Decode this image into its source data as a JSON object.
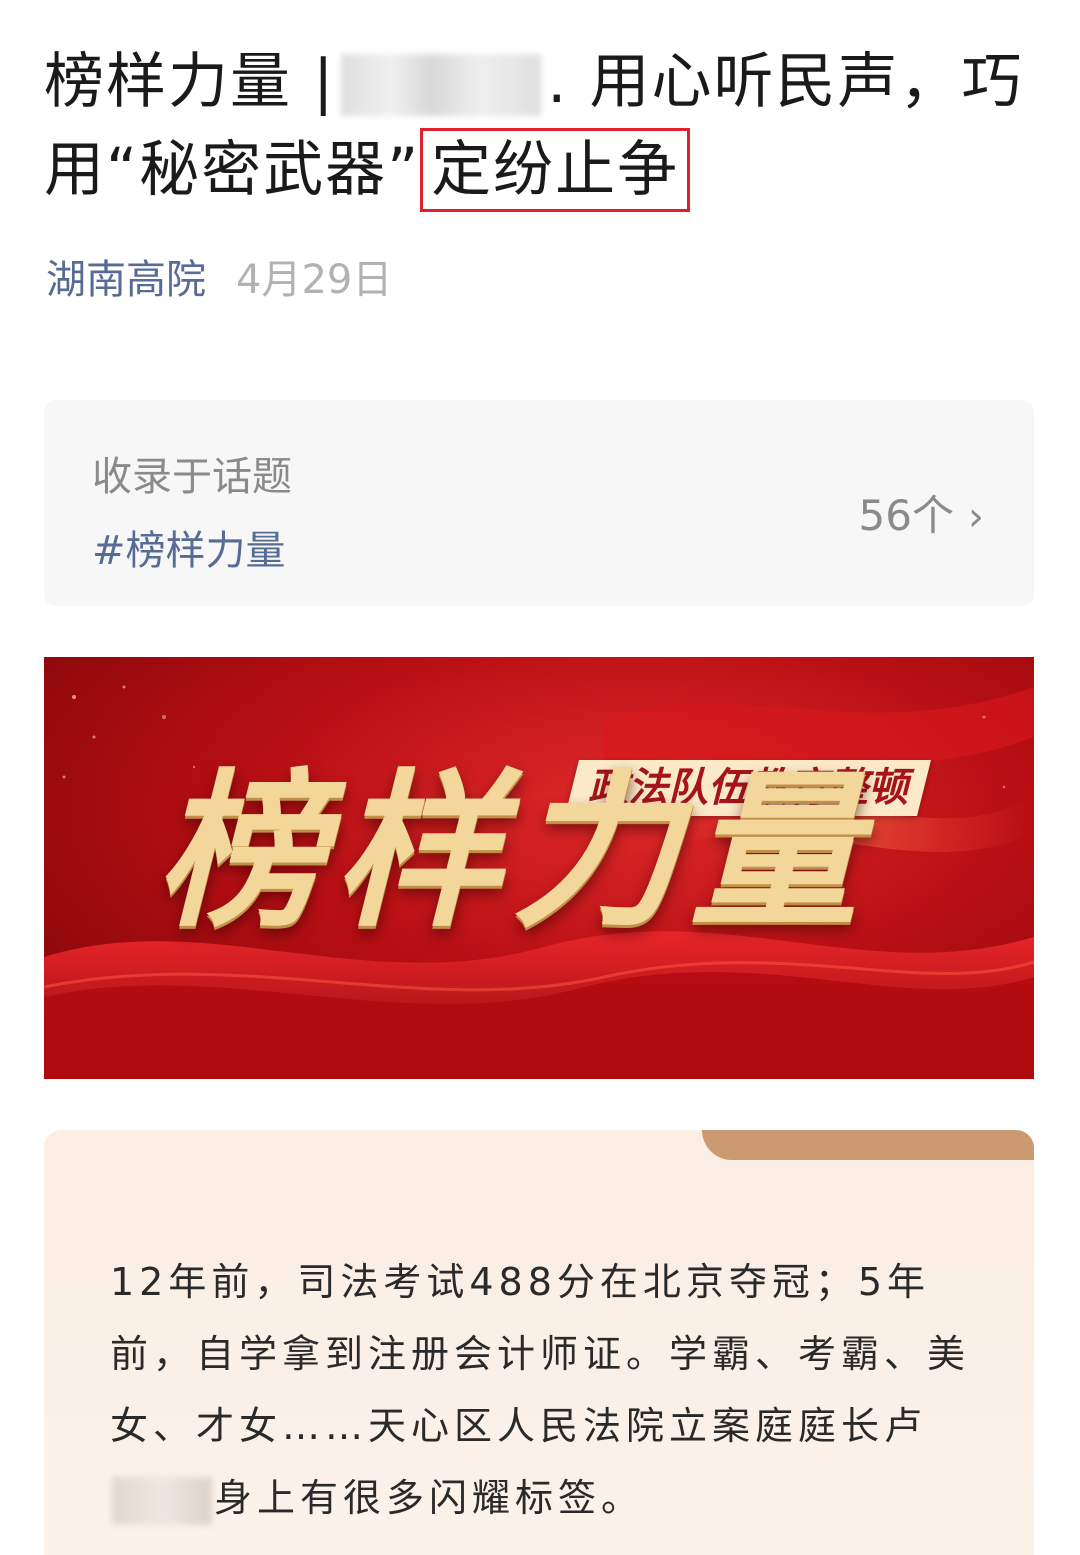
{
  "article": {
    "title_part1": "榜样力量 |",
    "title_part2": ". 用心听民声，巧用“秘密武器”",
    "title_highlight": "定纷止争",
    "account": "湖南高院",
    "date": "4月29日"
  },
  "topic": {
    "label": "收录于话题",
    "tag": "#榜样力量",
    "count": "56个",
    "chevron": "›"
  },
  "banner": {
    "subtitle": "政法队伍教育整顿",
    "headline": "榜样力量"
  },
  "intro": {
    "line1": "12年前，司法考试488分在北京夺冠；5年前，自学拿到注册会计师证。学霸、考霸、美女、才女……天心区人民法院立案庭庭长",
    "line2_prefix": "卢",
    "line2_suffix": "身上有很多闪耀标签。"
  },
  "colors": {
    "link": "#576b95",
    "highlight_border": "#e0202a",
    "banner_red": "#b80f14",
    "gold": "#f3d79a",
    "card_bg": "#fbeee3"
  }
}
